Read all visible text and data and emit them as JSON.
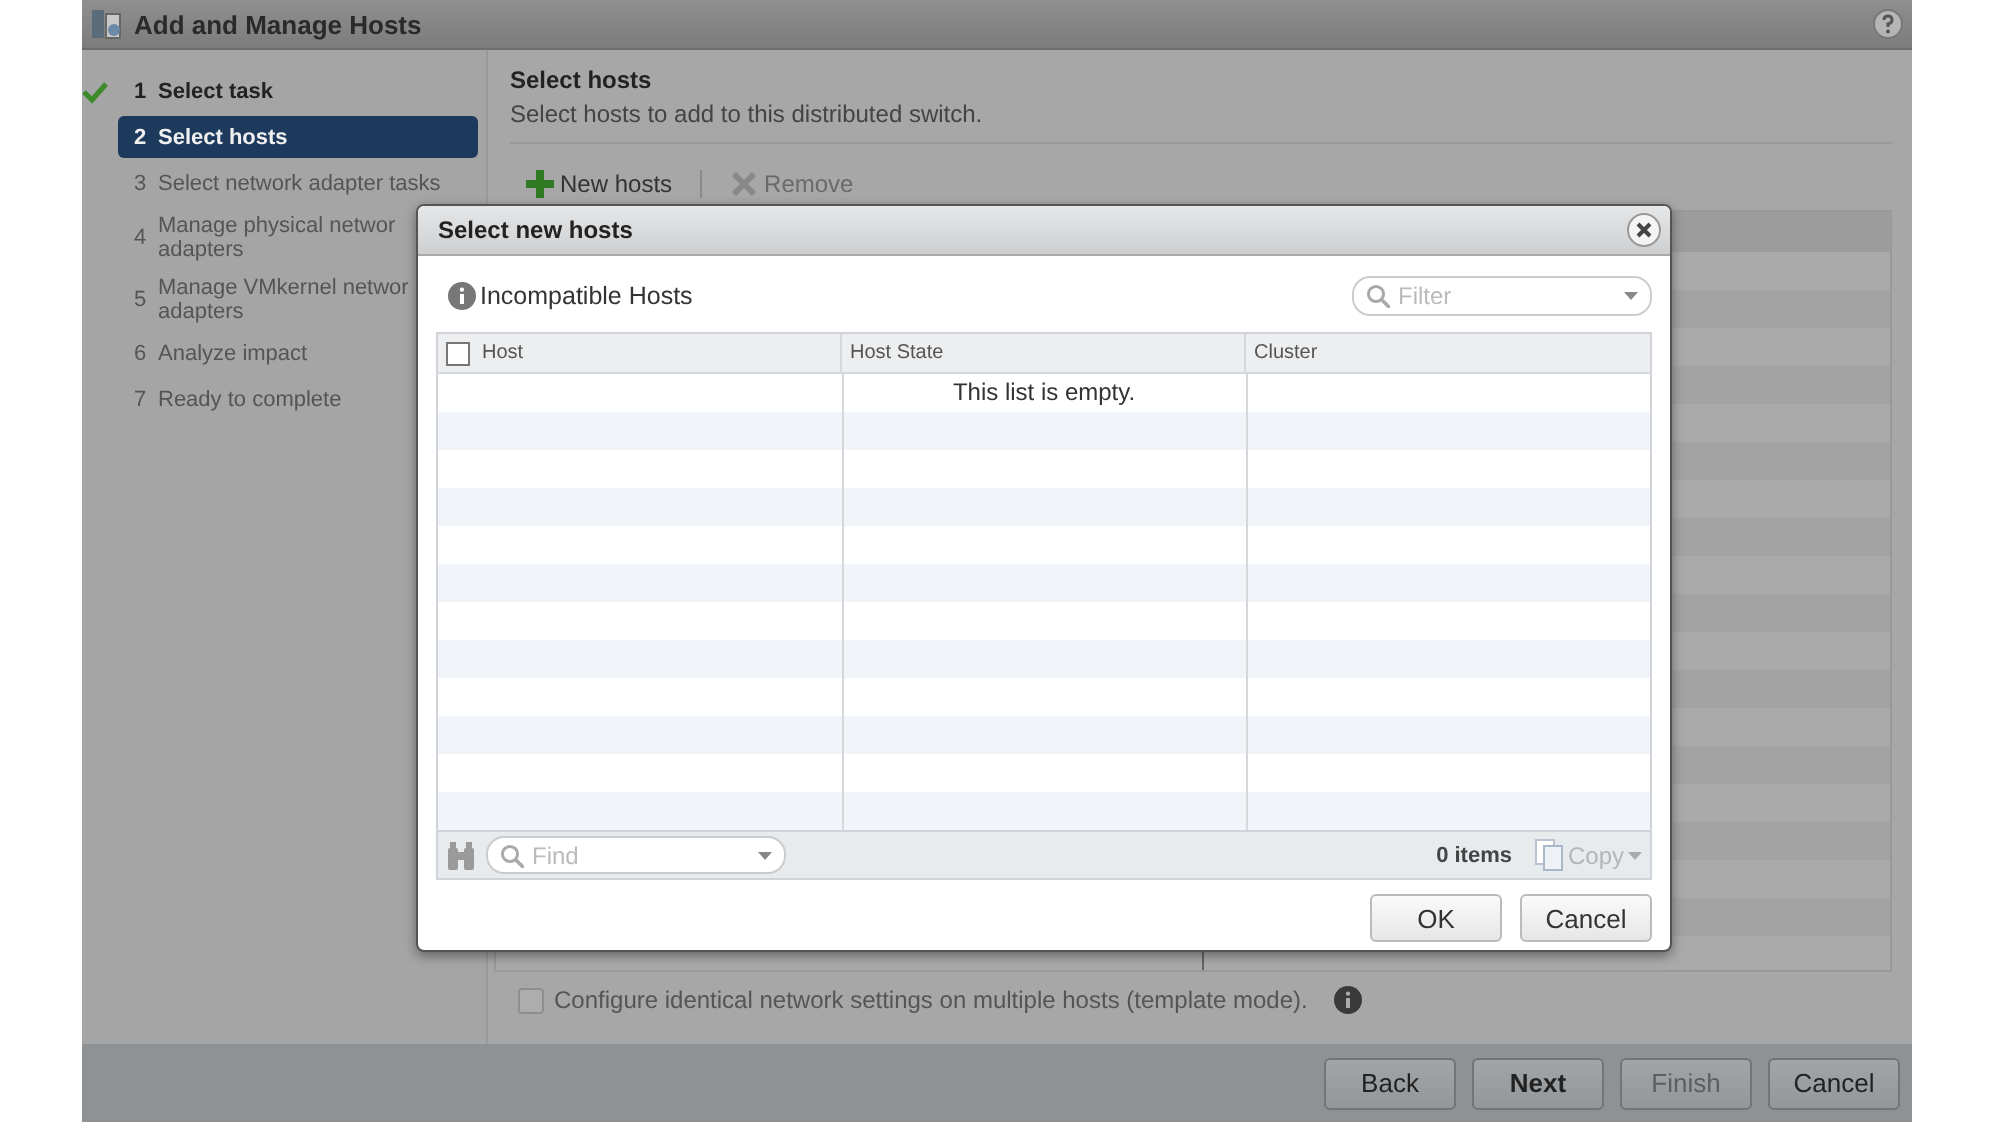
{
  "window": {
    "title": "Add and Manage Hosts"
  },
  "steps": [
    {
      "number": "1",
      "label": "Select task",
      "completed": true,
      "selected": false
    },
    {
      "number": "2",
      "label": "Select hosts",
      "completed": false,
      "selected": true
    },
    {
      "number": "3",
      "label": "Select network adapter tasks",
      "completed": false,
      "selected": false
    },
    {
      "number": "4",
      "label": "Manage physical networ\nadapters",
      "completed": false,
      "selected": false
    },
    {
      "number": "5",
      "label": "Manage VMkernel networ\nadapters",
      "completed": false,
      "selected": false
    },
    {
      "number": "6",
      "label": "Analyze impact",
      "completed": false,
      "selected": false
    },
    {
      "number": "7",
      "label": "Ready to complete",
      "completed": false,
      "selected": false
    }
  ],
  "content": {
    "heading": "Select hosts",
    "description": "Select hosts to add to this distributed switch.",
    "toolbar": [
      {
        "kind": "add",
        "label": "New hosts",
        "disabled": false
      },
      {
        "kind": "remove",
        "label": "Remove",
        "disabled": true
      }
    ],
    "template_mode": {
      "label": "Configure identical network settings on multiple hosts (template mode).",
      "checked": false
    }
  },
  "footer_buttons": [
    {
      "label": "Back",
      "disabled": false,
      "default": false
    },
    {
      "label": "Next",
      "disabled": false,
      "default": true
    },
    {
      "label": "Finish",
      "disabled": true,
      "default": false
    },
    {
      "label": "Cancel",
      "disabled": false,
      "default": false
    }
  ],
  "dialog": {
    "title": "Select new hosts",
    "heading": "Incompatible Hosts",
    "filter": {
      "placeholder": "Filter"
    },
    "select_all": {
      "checked": false
    },
    "columns": [
      "Host",
      "Host State",
      "Cluster"
    ],
    "empty_message": "This list is empty.",
    "find": {
      "placeholder": "Find"
    },
    "count": "0 items",
    "copy": "Copy",
    "buttons": [
      "OK",
      "Cancel"
    ]
  }
}
